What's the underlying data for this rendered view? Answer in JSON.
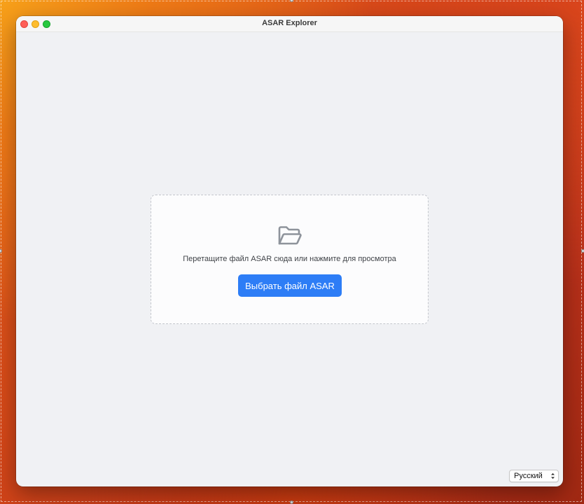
{
  "window": {
    "title": "ASAR Explorer"
  },
  "dropzone": {
    "icon": "folder-open-icon",
    "text": "Перетащите файл ASAR сюда или нажмите для просмотра",
    "button_label": "Выбрать файл ASAR"
  },
  "language": {
    "selected": "Русский"
  },
  "colors": {
    "accent": "#2d7df6",
    "window_bg": "#f0f1f4",
    "icon_gray": "#8e939b"
  }
}
